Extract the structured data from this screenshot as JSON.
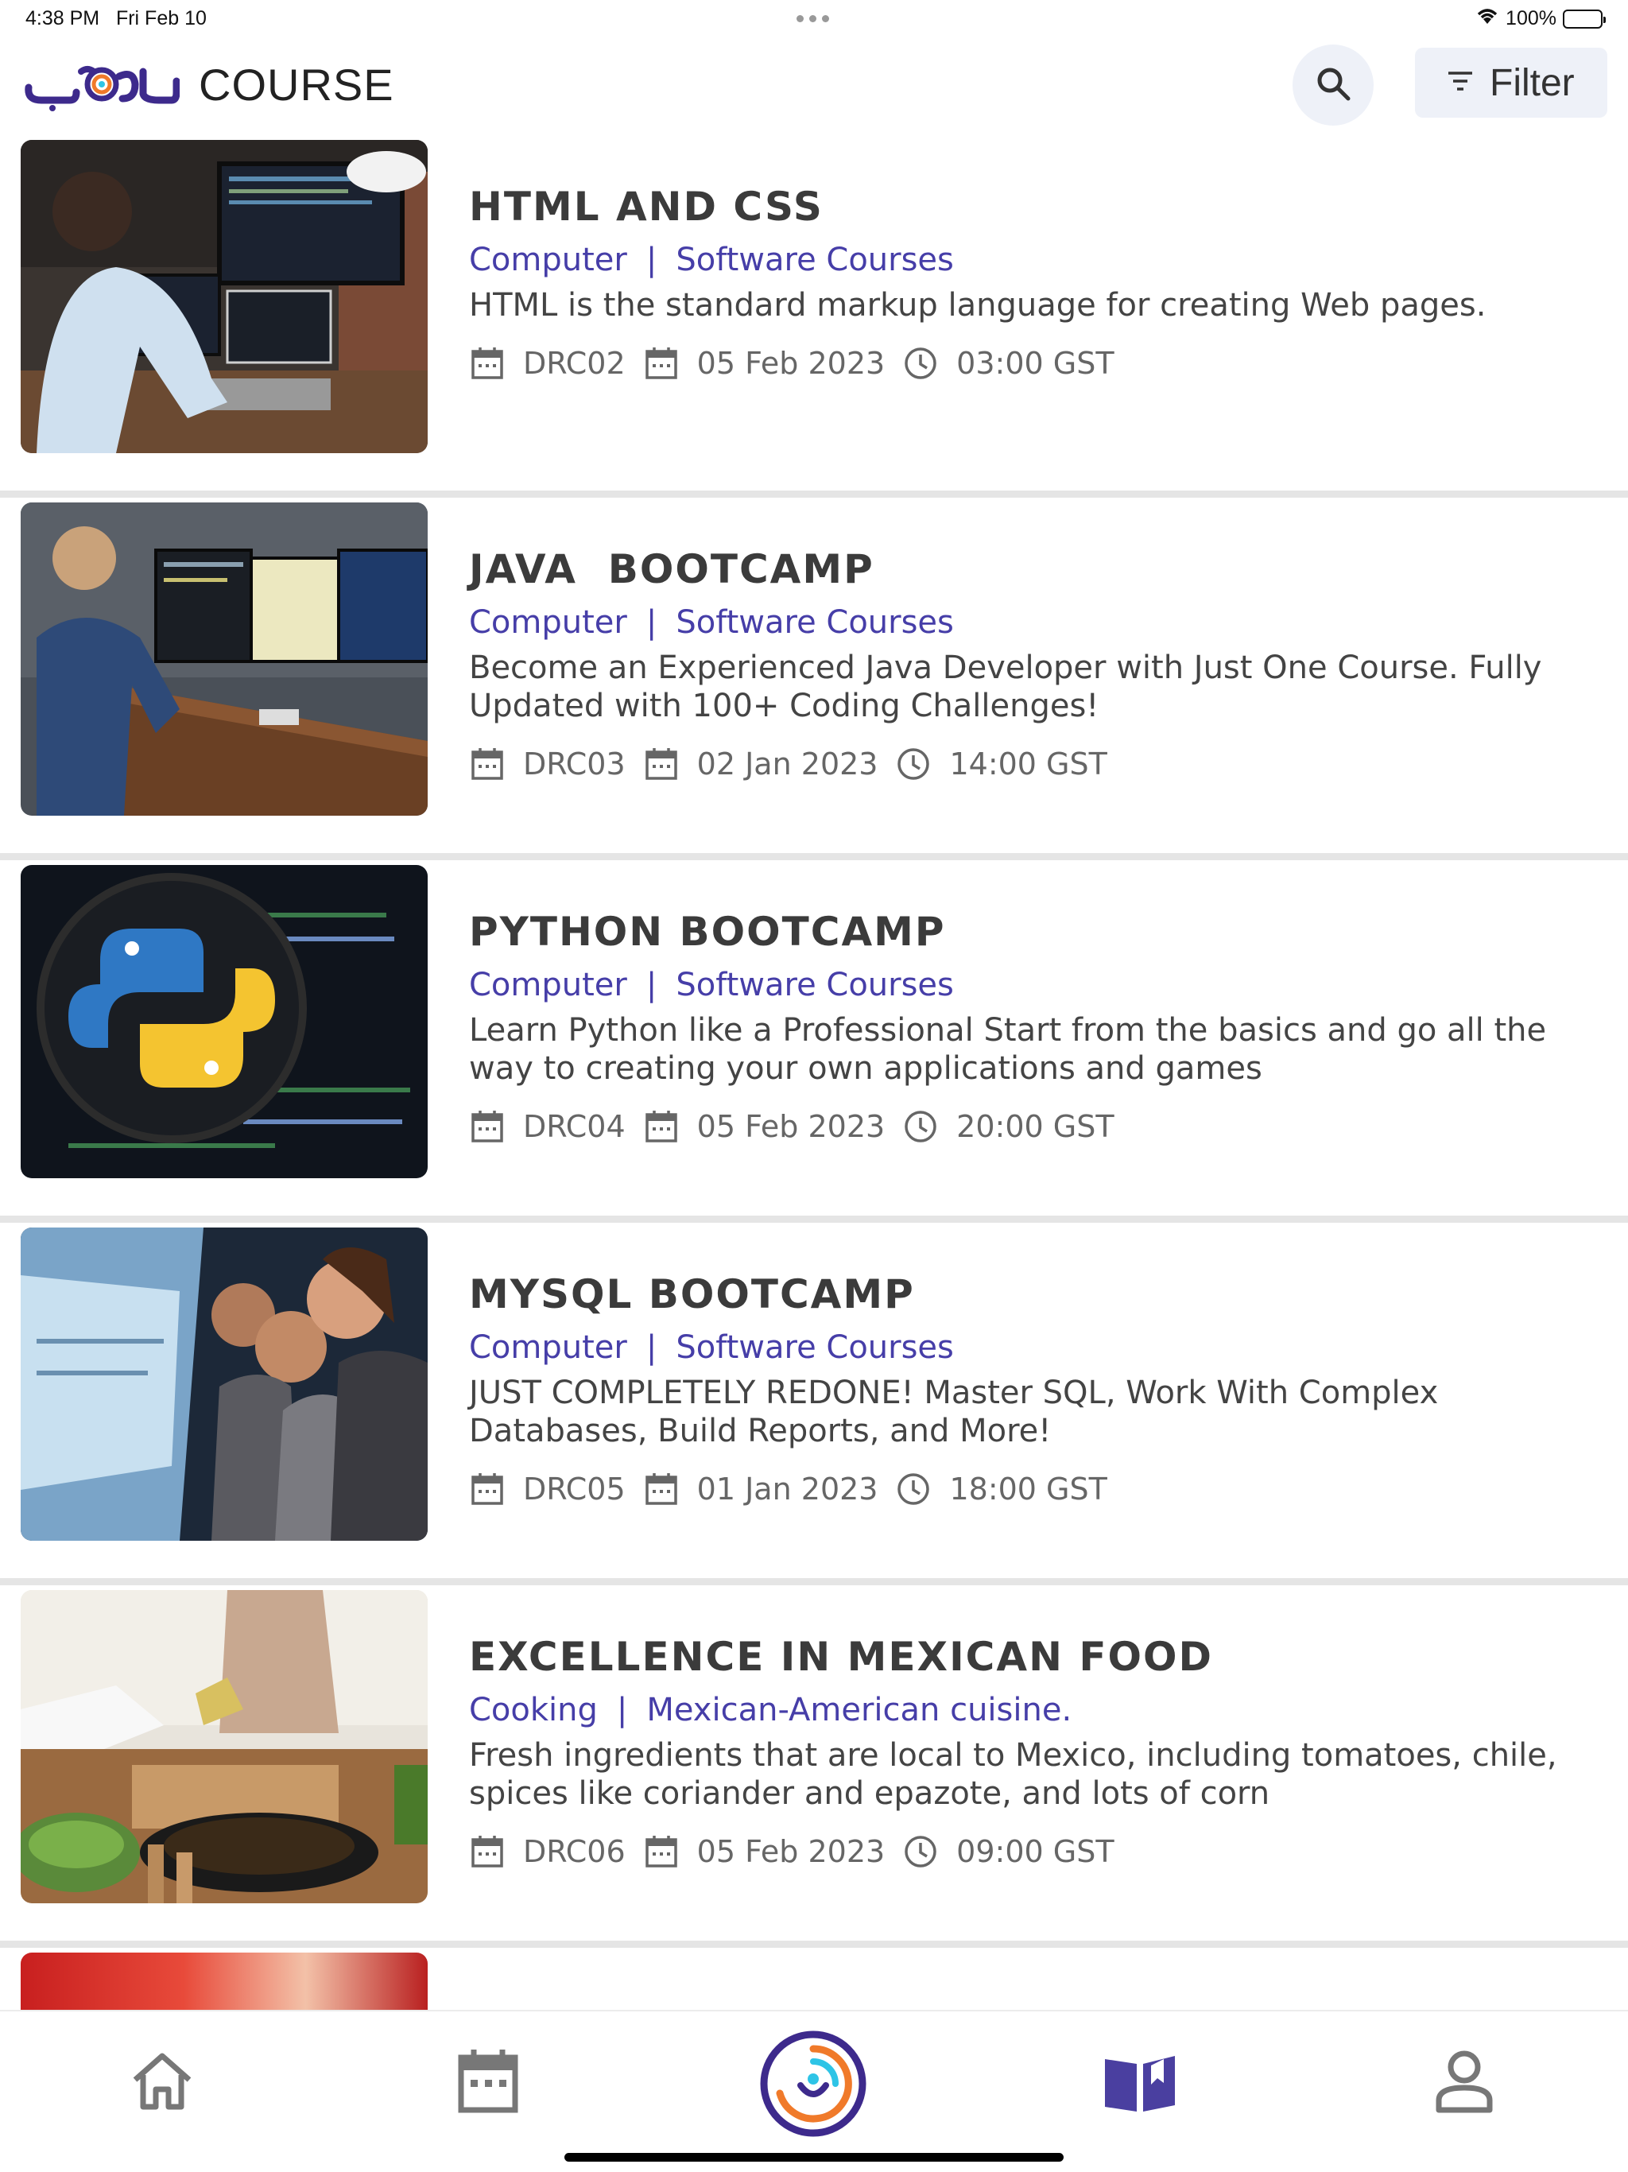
{
  "status_bar": {
    "time": "4:38 PM",
    "date": "Fri Feb 10",
    "battery": "100%"
  },
  "header": {
    "brand_logo": "دروب",
    "title": "COURSE",
    "filter_label": "Filter"
  },
  "courses": [
    {
      "title": "HTML AND CSS",
      "category": "Computer",
      "subcategory": "Software Courses",
      "description": "HTML is the standard markup language for creating Web pages.",
      "code": "DRC02",
      "date": "05 Feb 2023",
      "time": "03:00 GST",
      "image": "developer-at-desk"
    },
    {
      "title": "JAVA  BOOTCAMP",
      "category": "Computer",
      "subcategory": "Software Courses",
      "description": "Become an Experienced Java Developer with Just One Course. Fully Updated with 100+ Coding Challenges!",
      "code": "DRC03",
      "date": "02 Jan 2023",
      "time": "14:00 GST",
      "image": "developer-standing-monitors"
    },
    {
      "title": "PYTHON BOOTCAMP",
      "category": "Computer",
      "subcategory": "Software Courses",
      "description": "Learn Python like a Professional Start from the basics and go all the way to creating your own applications and games",
      "code": "DRC04",
      "date": "05 Feb 2023",
      "time": "20:00 GST",
      "image": "python-logo-magnifier"
    },
    {
      "title": "MYSQL BOOTCAMP",
      "category": "Computer",
      "subcategory": "Software Courses",
      "description": "JUST COMPLETELY REDONE! Master SQL, Work With Complex Databases, Build Reports, and More!",
      "code": "DRC05",
      "date": "01 Jan 2023",
      "time": "18:00 GST",
      "image": "team-looking-at-screen"
    },
    {
      "title": "EXCELLENCE IN MEXICAN FOOD",
      "category": "Cooking",
      "subcategory": "Mexican-American cuisine.",
      "description": "Fresh ingredients that are local to Mexico, including tomatoes, chile, spices like coriander and epazote, and lots of corn",
      "code": "DRC06",
      "date": "05 Feb 2023",
      "time": "09:00 GST",
      "image": "chef-cooking"
    }
  ],
  "tabs": [
    {
      "name": "home",
      "icon": "home-icon"
    },
    {
      "name": "calendar",
      "icon": "calendar-icon"
    },
    {
      "name": "droob",
      "icon": "droob-logo-icon"
    },
    {
      "name": "courses",
      "icon": "book-icon"
    },
    {
      "name": "profile",
      "icon": "person-icon"
    }
  ],
  "colors": {
    "accent": "#463ea8",
    "brand_purple": "#3d2a8c",
    "brand_orange": "#f07a2a",
    "brand_cyan": "#2ec4e6",
    "divider": "#e5e5e5"
  }
}
